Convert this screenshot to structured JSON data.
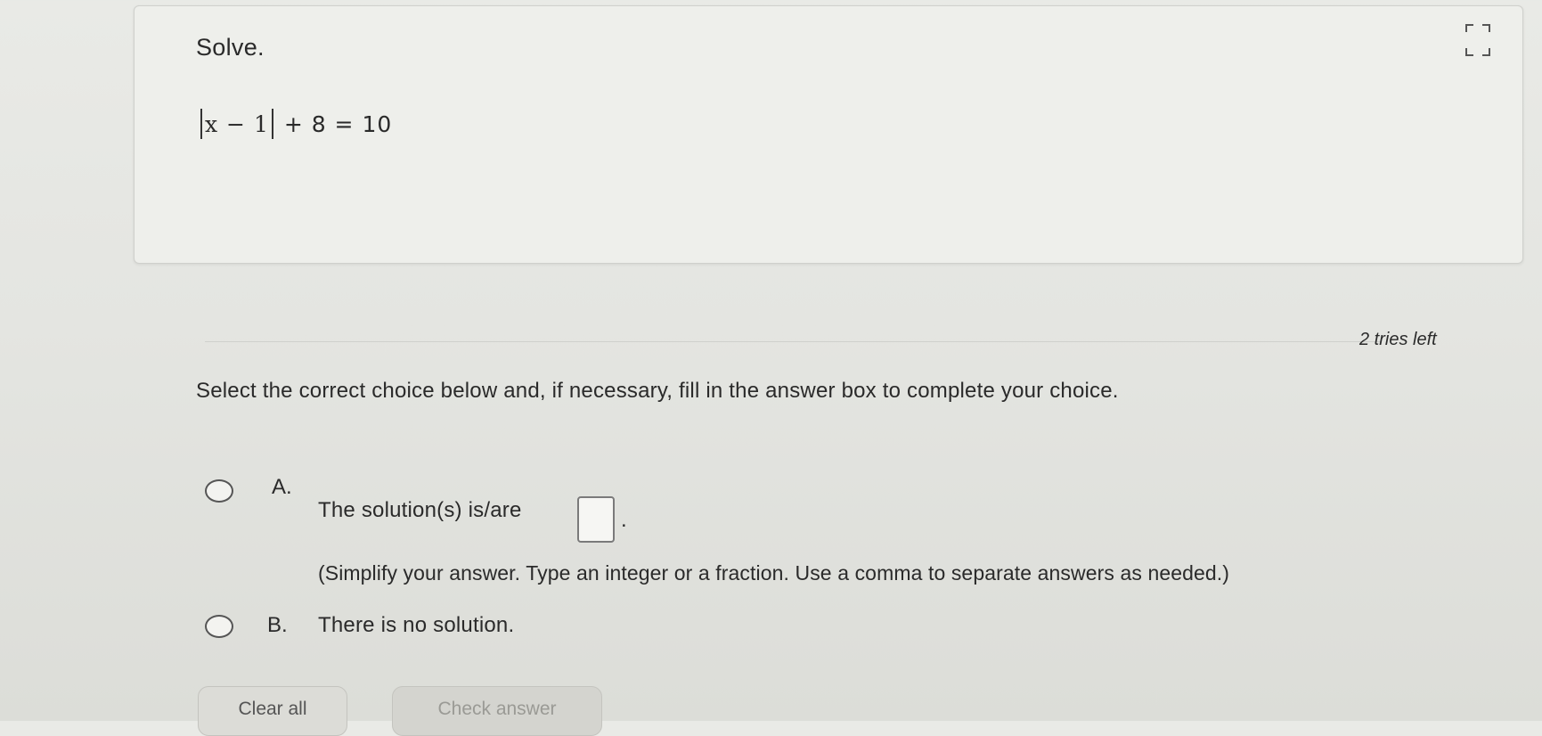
{
  "question": {
    "title": "Solve.",
    "equation": {
      "abs_expression": "x − 1",
      "rest": "+ 8 = 10"
    },
    "expand_icon": "expand-icon"
  },
  "answer_panel": {
    "tries_left": "2 tries left",
    "instructions": "Select the correct choice below and, if necessary, fill in the answer box to complete your choice.",
    "choices": [
      {
        "letter": "A.",
        "text": "The solution(s) is/are",
        "answer_value": "",
        "after_box": ".",
        "hint": "(Simplify your answer. Type an integer or a fraction. Use a comma to separate answers as needed.)"
      },
      {
        "letter": "B.",
        "text": "There is no solution."
      }
    ]
  },
  "buttons": {
    "clear_all": "Clear all",
    "check_answer": "Check answer"
  }
}
